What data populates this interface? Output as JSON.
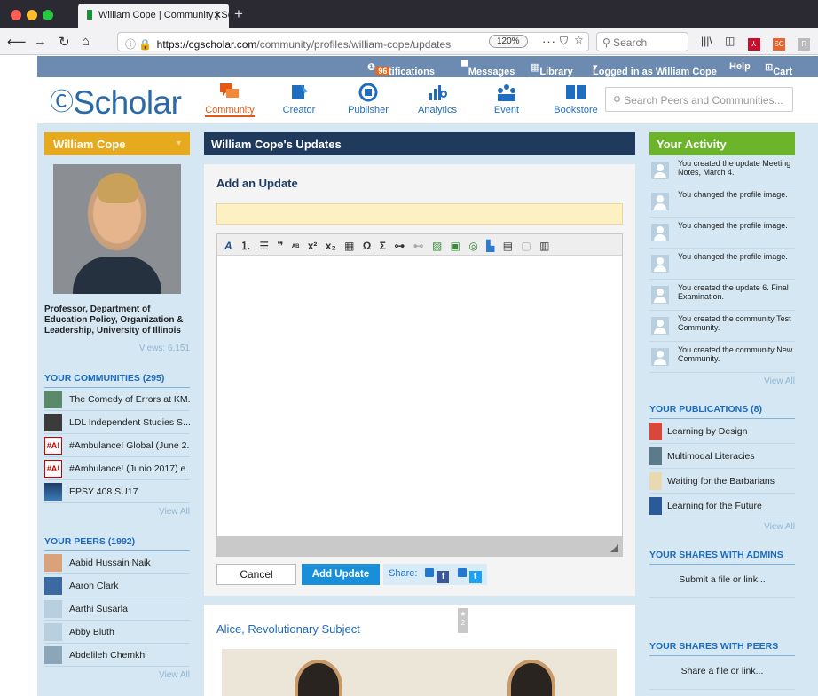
{
  "browser": {
    "tab_title": "William Cope | Community | Sch",
    "new_tab": "+",
    "url_domain": "https://cgscholar.com",
    "url_path": "/community/profiles/william-cope/updates",
    "zoom": "120%",
    "more": "···",
    "search_placeholder": "Search"
  },
  "topbar": {
    "notifications": "Notifications",
    "notifications_count": "96",
    "messages": "Messages",
    "library": "Library",
    "logged_in": "Logged in as William Cope",
    "help": "Help",
    "cart": "Cart"
  },
  "header": {
    "logo": "Scholar",
    "nav": [
      {
        "label": "Community",
        "color": "#e35a12"
      },
      {
        "label": "Creator",
        "color": "#1f6dbf"
      },
      {
        "label": "Publisher",
        "color": "#1f6dbf"
      },
      {
        "label": "Analytics",
        "color": "#1f6dbf"
      },
      {
        "label": "Event",
        "color": "#1f6dbf"
      },
      {
        "label": "Bookstore",
        "color": "#1f6dbf"
      }
    ],
    "search_placeholder": "Search Peers and Communities..."
  },
  "profile": {
    "name": "William Cope",
    "description": "Professor, Department of Education Policy, Organization & Leadership, University of Illinois",
    "views": "Views: 6,151"
  },
  "communities": {
    "title": "YOUR COMMUNITIES (295)",
    "items": [
      "The Comedy of Errors at KM...",
      "LDL Independent Studies S...",
      "#Ambulance! Global (June 2...",
      "#Ambulance! (Junio 2017) e...",
      "EPSY 408 SU17"
    ],
    "view_all": "View All"
  },
  "peers": {
    "title": "YOUR PEERS (1992)",
    "items": [
      "Aabid Hussain Naik",
      "Aaron Clark",
      "Aarthi Susarla",
      "Abby Bluth",
      "Abdelileh Chemkhi"
    ],
    "view_all": "View All"
  },
  "main": {
    "title": "William Cope's Updates",
    "add_title": "Add an Update",
    "cancel": "Cancel",
    "add_button": "Add Update",
    "share_label": "Share:",
    "post_title": "Alice, Revolutionary Subject",
    "post_badge": "2"
  },
  "activity": {
    "title": "Your Activity",
    "items": [
      "You created the update Meeting Notes, March 4.",
      "You changed the profile image.",
      "You changed the profile image.",
      "You changed the profile image.",
      "You created the update 6. Final Examination.",
      "You created the community Test Community.",
      "You created the community New Community."
    ],
    "view_all": "View All"
  },
  "publications": {
    "title": "YOUR PUBLICATIONS (8)",
    "items": [
      "Learning by Design",
      "Multimodal Literacies",
      "Waiting for the Barbarians",
      "Learning for the Future"
    ],
    "view_all": "View All"
  },
  "shares_admins": {
    "title": "YOUR SHARES WITH ADMINS",
    "action": "Submit a file or link..."
  },
  "shares_peers": {
    "title": "YOUR SHARES WITH PEERS",
    "action": "Share a file or link..."
  }
}
